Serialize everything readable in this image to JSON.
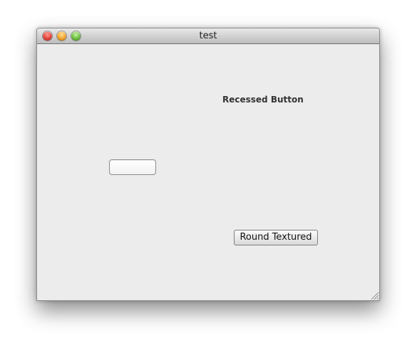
{
  "window": {
    "title": "test",
    "traffic_lights": {
      "close_icon": "close-icon",
      "minimize_icon": "minimize-icon",
      "zoom_icon": "zoom-icon"
    }
  },
  "content": {
    "recessed_button_label": "Recessed Button",
    "recessed_button_text": "",
    "round_textured_button_label": "Round Textured"
  },
  "icons": {
    "resize": "resize-grip-icon"
  }
}
